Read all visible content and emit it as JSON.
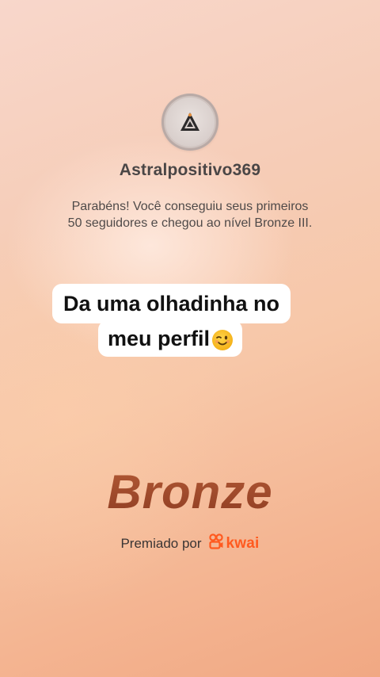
{
  "profile": {
    "avatar_icon": "astral-logo-icon",
    "username": "Astralpositivo369"
  },
  "message": {
    "line1": "Parabéns! Você conseguiu seus primeiros",
    "line2": "50 seguidores e chegou ao nível Bronze III."
  },
  "caption": {
    "line1": "Da uma olhadinha no",
    "line2": "meu perfil",
    "emoji_icon": "winking-face-icon"
  },
  "badge": {
    "level": "Bronze",
    "color": "#a64e2f"
  },
  "footer": {
    "awarded_by": "Premiado por",
    "brand_icon": "kwai-logo-icon",
    "brand": "kwai",
    "brand_color": "#ff5a1f"
  }
}
